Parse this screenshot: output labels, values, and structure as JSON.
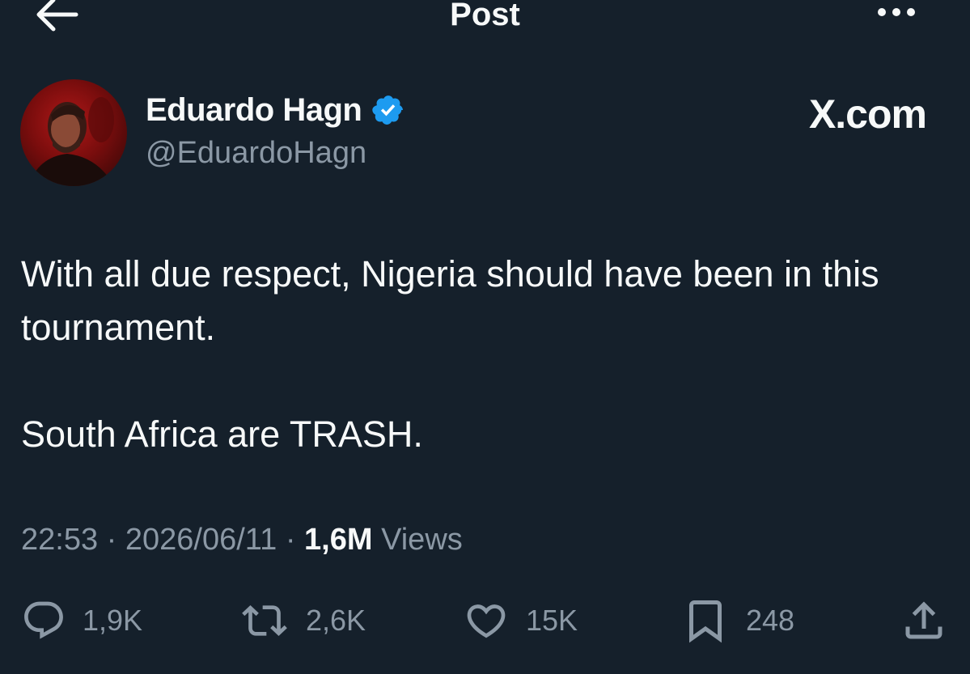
{
  "header": {
    "title": "Post"
  },
  "author": {
    "display_name": "Eduardo Hagn",
    "handle": "@EduardoHagn",
    "verified": true
  },
  "source": "X.com",
  "tweet": {
    "paragraphs": [
      "With all due respect, Nigeria should have been in this tournament.",
      "South Africa are TRASH."
    ]
  },
  "meta": {
    "time": "22:53",
    "separator": "·",
    "date": "2026/06/11",
    "views_count": "1,6M",
    "views_label": "Views"
  },
  "actions": {
    "replies": "1,9K",
    "reposts": "2,6K",
    "likes": "15K",
    "bookmarks": "248"
  },
  "colors": {
    "background": "#15202b",
    "text": "#f7f9f9",
    "muted": "#8b98a5",
    "verified": "#1d9bf0"
  },
  "icons": {
    "back": "arrow-left-icon",
    "more": "more-horizontal-icon",
    "verified": "verified-badge-icon",
    "reply": "reply-icon",
    "repost": "repost-icon",
    "like": "heart-icon",
    "bookmark": "bookmark-icon",
    "share": "share-icon"
  }
}
